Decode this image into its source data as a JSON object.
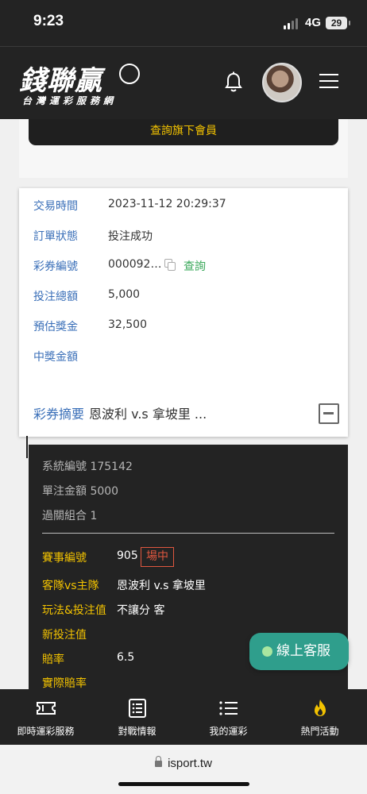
{
  "status_bar": {
    "time": "9:23",
    "network": "4G",
    "battery": "29"
  },
  "header": {
    "logo_text": "錢聯贏",
    "logo_subtitle": "台灣運彩服務網"
  },
  "query_button": "查詢旗下會員",
  "detail": {
    "rows": [
      {
        "label": "交易時間",
        "value": "2023-11-12 20:29:37"
      },
      {
        "label": "訂單狀態",
        "value": "投注成功"
      },
      {
        "label": "彩券編號",
        "value": "000092…",
        "link": "查詢"
      },
      {
        "label": "投注總額",
        "value": "5,000"
      },
      {
        "label": "預估獎金",
        "value": "32,500"
      },
      {
        "label": "中獎金額",
        "value": ""
      }
    ],
    "summary_label": "彩券摘要",
    "summary_value": "恩波利 v.s 拿坡里 ..."
  },
  "breakdown": {
    "system_no": "系統編號 175142",
    "unit_amount": "單注金額 5000",
    "parlay": "過關組合 1",
    "fields": [
      {
        "label": "賽事編號",
        "value": "905",
        "badge": "場中"
      },
      {
        "label": "客隊vs主隊",
        "value": "恩波利 v.s 拿坡里"
      },
      {
        "label": "玩法&投注值",
        "value": "不讓分 客"
      },
      {
        "label": "新投注值",
        "value": ""
      },
      {
        "label": "賠率",
        "value": "6.5"
      },
      {
        "label": "實際賠率",
        "value": ""
      }
    ]
  },
  "cs_button": "線上客服",
  "bottom_nav": [
    {
      "label": "即時運彩服務",
      "icon": "ticket-icon"
    },
    {
      "label": "對戰情報",
      "icon": "list-doc-icon"
    },
    {
      "label": "我的運彩",
      "icon": "list-icon"
    },
    {
      "label": "熱門活動",
      "icon": "flame-icon"
    }
  ],
  "url": "isport.tw"
}
